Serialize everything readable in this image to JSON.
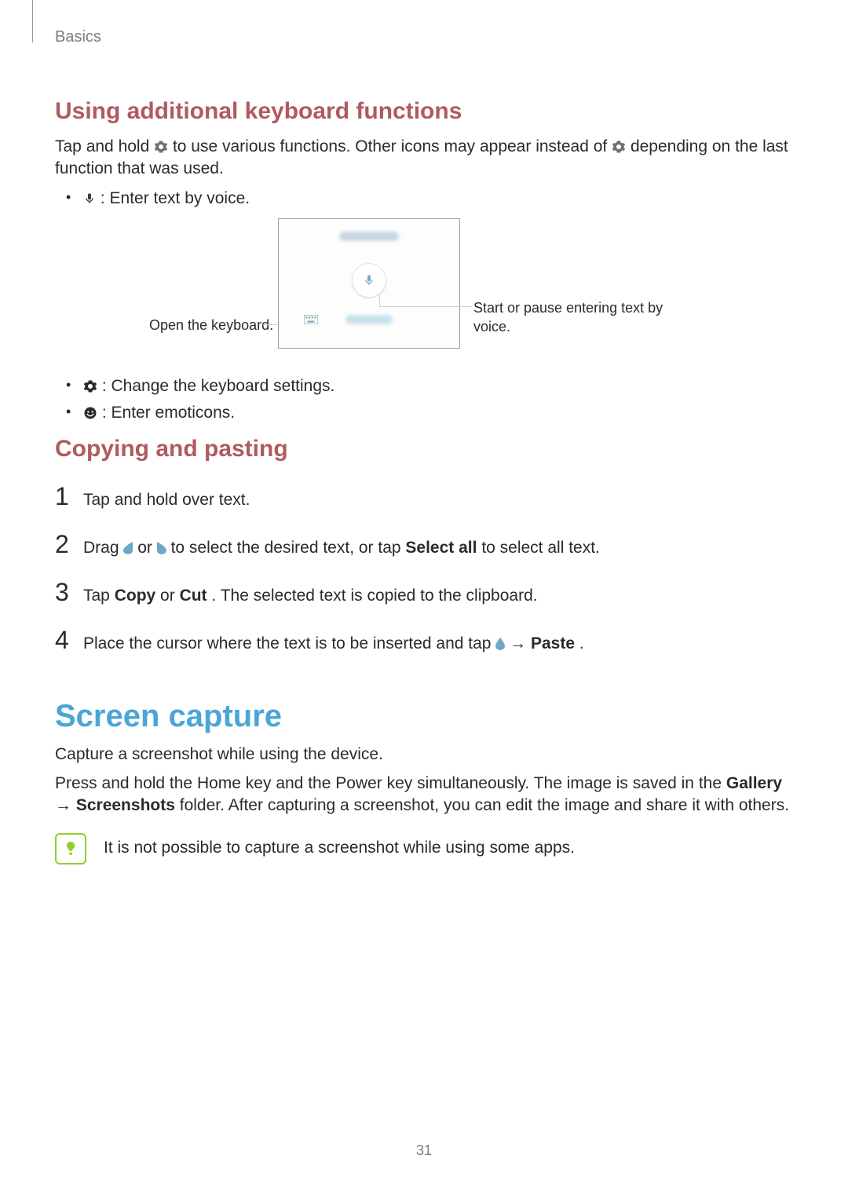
{
  "chapter": "Basics",
  "page_number": "31",
  "section1": {
    "heading": "Using additional keyboard functions",
    "para_before": "Tap and hold ",
    "para_mid": " to use various functions. Other icons may appear instead of ",
    "para_after": " depending on the last function that was used.",
    "bullets": {
      "voice": " : Enter text by voice.",
      "settings": " : Change the keyboard settings.",
      "emoticons": " : Enter emoticons."
    },
    "callouts": {
      "left": "Open the keyboard.",
      "right": "Start or pause entering text by voice."
    }
  },
  "section2": {
    "heading": "Copying and pasting",
    "steps": {
      "n1": "1",
      "t1": "Tap and hold over text.",
      "n2": "2",
      "t2a": "Drag ",
      "t2b": " or ",
      "t2c": " to select the desired text, or tap ",
      "t2d": "Select all",
      "t2e": " to select all text.",
      "n3": "3",
      "t3a": "Tap ",
      "t3b": "Copy",
      "t3c": " or ",
      "t3d": "Cut",
      "t3e": ". The selected text is copied to the clipboard.",
      "n4": "4",
      "t4a": "Place the cursor where the text is to be inserted and tap ",
      "t4arrow": " → ",
      "t4b": "Paste",
      "t4c": "."
    }
  },
  "section3": {
    "heading": "Screen capture",
    "p1": "Capture a screenshot while using the device.",
    "p2a": "Press and hold the Home key and the Power key simultaneously. The image is saved in the ",
    "p2b": "Gallery",
    "p2arrow": " → ",
    "p2c": "Screenshots",
    "p2d": " folder. After capturing a screenshot, you can edit the image and share it with others.",
    "note": "It is not possible to capture a screenshot while using some apps."
  }
}
